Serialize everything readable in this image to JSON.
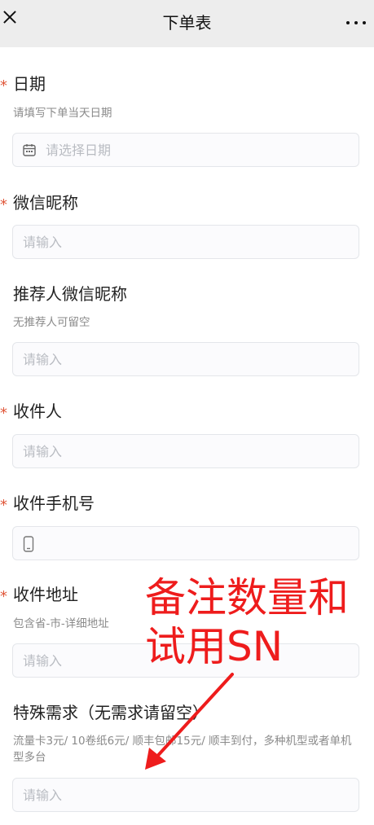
{
  "header": {
    "title": "下单表",
    "close_icon": "close-icon",
    "more_icon": "more-icon"
  },
  "form": {
    "date": {
      "required": "*",
      "label": "日期",
      "hint": "请填写下单当天日期",
      "placeholder": "请选择日期",
      "icon": "calendar-icon"
    },
    "wechat_nickname": {
      "required": "*",
      "label": "微信昵称",
      "placeholder": "请输入"
    },
    "referrer": {
      "label": "推荐人微信昵称",
      "hint": "无推荐人可留空",
      "placeholder": "请输入"
    },
    "recipient": {
      "required": "*",
      "label": "收件人",
      "placeholder": "请输入"
    },
    "phone": {
      "required": "*",
      "label": "收件手机号",
      "icon": "phone-icon"
    },
    "address": {
      "required": "*",
      "label": "收件地址",
      "hint": "包含省-市-详细地址",
      "placeholder": "请输入"
    },
    "special": {
      "label": "特殊需求（无需求请留空）",
      "hint": "流量卡3元/ 10卷纸6元/ 顺丰包邮15元/ 顺丰到付，多种机型或者单机型多台",
      "placeholder": "请输入"
    }
  },
  "annotation": {
    "text_line1": "备注数量和",
    "text_line2": "试用SN",
    "color": "#ee1c1c"
  }
}
